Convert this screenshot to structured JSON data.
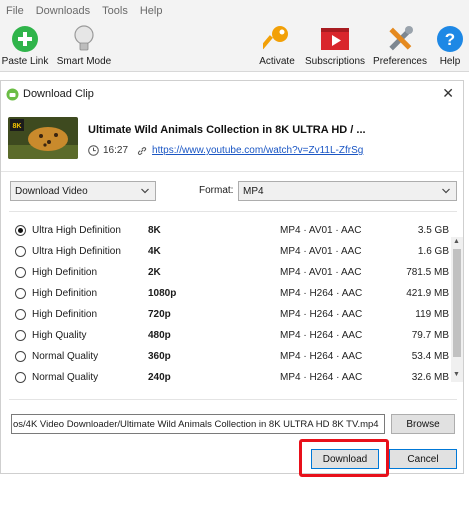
{
  "menu": [
    "File",
    "Downloads",
    "Tools",
    "Help"
  ],
  "toolbar": {
    "paste_link": "Paste Link",
    "smart_mode": "Smart Mode",
    "activate": "Activate",
    "subscriptions": "Subscriptions",
    "preferences": "Preferences",
    "help": "Help"
  },
  "dialog": {
    "title": "Download Clip",
    "clip": {
      "title": "Ultimate Wild Animals Collection in 8K ULTRA HD / ...",
      "duration": "16:27",
      "url": "https://www.youtube.com/watch?v=Zv11L-ZfrSg"
    },
    "type_select": "Download Video",
    "format_label": "Format:",
    "format_select": "MP4",
    "options": [
      {
        "quality": "Ultra High Definition",
        "resolution": "8K",
        "codec": "MP4 · AV01 · AAC",
        "size": "3.5 GB",
        "selected": true
      },
      {
        "quality": "Ultra High Definition",
        "resolution": "4K",
        "codec": "MP4 · AV01 · AAC",
        "size": "1.6 GB",
        "selected": false
      },
      {
        "quality": "High Definition",
        "resolution": "2K",
        "codec": "MP4 · AV01 · AAC",
        "size": "781.5 MB",
        "selected": false
      },
      {
        "quality": "High Definition",
        "resolution": "1080p",
        "codec": "MP4 · H264 · AAC",
        "size": "421.9 MB",
        "selected": false
      },
      {
        "quality": "High Definition",
        "resolution": "720p",
        "codec": "MP4 · H264 · AAC",
        "size": "119 MB",
        "selected": false
      },
      {
        "quality": "High Quality",
        "resolution": "480p",
        "codec": "MP4 · H264 · AAC",
        "size": "79.7 MB",
        "selected": false
      },
      {
        "quality": "Normal Quality",
        "resolution": "360p",
        "codec": "MP4 · H264 · AAC",
        "size": "53.4 MB",
        "selected": false
      },
      {
        "quality": "Normal Quality",
        "resolution": "240p",
        "codec": "MP4 · H264 · AAC",
        "size": "32.6 MB",
        "selected": false
      }
    ],
    "save_path": "os/4K Video Downloader/Ultimate Wild Animals Collection in 8K ULTRA HD   8K TV.mp4",
    "browse": "Browse",
    "download": "Download",
    "cancel": "Cancel"
  },
  "colors": {
    "accent_blue": "#0078d7",
    "link": "#1a56c4",
    "highlight_red": "#e8101a",
    "paste_green": "#2fb44a",
    "help_blue": "#1e88e5",
    "key_gold": "#f2a007",
    "subscriptions_red": "#d9262c"
  },
  "icons": [
    "paste-link-icon",
    "smart-mode-bulb-icon",
    "activate-key-icon",
    "subscriptions-icon",
    "preferences-tools-icon",
    "help-icon",
    "app-logo-icon",
    "close-icon",
    "clock-icon",
    "link-icon",
    "chevron-down-icon"
  ]
}
